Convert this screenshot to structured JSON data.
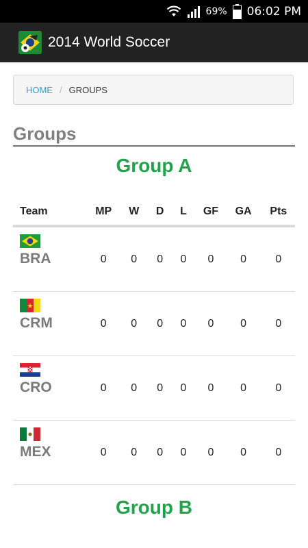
{
  "status_bar": {
    "battery_percent": "69%",
    "time": "06:02 PM",
    "icons": [
      "wifi-icon",
      "signal-icon",
      "battery-icon"
    ]
  },
  "app_bar": {
    "title": "2014 World Soccer",
    "icon": "app-logo-icon"
  },
  "breadcrumb": {
    "home": "HOME",
    "separator": "/",
    "current": "GROUPS"
  },
  "page": {
    "title": "Groups"
  },
  "groups": [
    {
      "name": "Group A",
      "columns": [
        "Team",
        "MP",
        "W",
        "D",
        "L",
        "GF",
        "GA",
        "Pts"
      ],
      "teams": [
        {
          "code": "BRA",
          "flag": "brazil-flag-icon",
          "mp": "0",
          "w": "0",
          "d": "0",
          "l": "0",
          "gf": "0",
          "ga": "0",
          "pts": "0"
        },
        {
          "code": "CRM",
          "flag": "cameroon-flag-icon",
          "mp": "0",
          "w": "0",
          "d": "0",
          "l": "0",
          "gf": "0",
          "ga": "0",
          "pts": "0"
        },
        {
          "code": "CRO",
          "flag": "croatia-flag-icon",
          "mp": "0",
          "w": "0",
          "d": "0",
          "l": "0",
          "gf": "0",
          "ga": "0",
          "pts": "0"
        },
        {
          "code": "MEX",
          "flag": "mexico-flag-icon",
          "mp": "0",
          "w": "0",
          "d": "0",
          "l": "0",
          "gf": "0",
          "ga": "0",
          "pts": "0"
        }
      ]
    },
    {
      "name": "Group B"
    }
  ],
  "colors": {
    "accent_green": "#22a34b",
    "link_blue": "#2a9fd6",
    "action_bar": "#222222"
  }
}
